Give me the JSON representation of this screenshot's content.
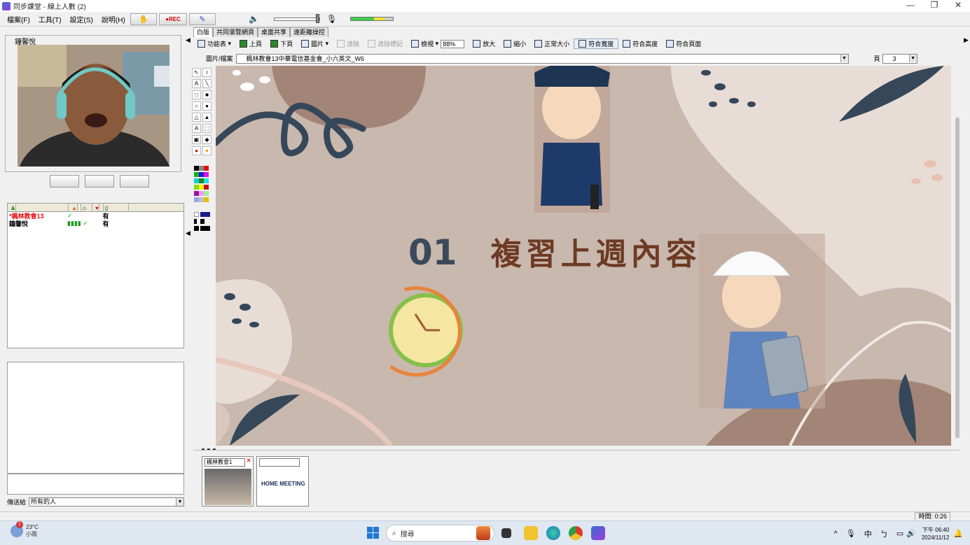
{
  "window": {
    "title": "同步課堂 - 線上人數 (2)",
    "controls": [
      "—",
      "❐",
      "✕"
    ]
  },
  "menu": {
    "items": [
      "檔案(F)",
      "工具(T)",
      "設定(S)",
      "說明(H)"
    ]
  },
  "toolbar": {
    "rec_label": "●REC"
  },
  "video": {
    "label": "鐘馨悅"
  },
  "users": {
    "rows": [
      {
        "name": "*楓林教會13",
        "status": "✓",
        "val": "有",
        "color": "#e01010"
      },
      {
        "name": "鐘馨悅",
        "status": "▮▮▮▮ ✓",
        "val": "有",
        "color": "#000000"
      }
    ]
  },
  "chat": {
    "send_to_label": "傳送給",
    "send_to_value": "所有的人"
  },
  "tabs": [
    {
      "label": "白版",
      "active": true
    },
    {
      "label": "共同瀏覽網頁",
      "active": false
    },
    {
      "label": "桌面共享",
      "active": false
    },
    {
      "label": "遠距離操控",
      "active": false
    }
  ],
  "whiteboard_toolbar": {
    "function_table": "功能表",
    "prev_page": "上頁",
    "next_page": "下頁",
    "image": "圖片",
    "clear": "清除",
    "clear_marks": "清除標記",
    "view": "檢視",
    "zoom_value": "88%",
    "zoom_in": "放大",
    "zoom_out": "縮小",
    "normal_size": "正常大小",
    "fit_width": "符合寬度",
    "fit_height": "符合高度",
    "fit_page": "符合頁面"
  },
  "path": {
    "label": "圖片/檔案",
    "value": "楓林教會13中華電信基金會_小六英文_W6",
    "page_label": "頁",
    "page_value": "3"
  },
  "slide": {
    "number": "01",
    "title": "複習上週內容"
  },
  "thumbnails": [
    {
      "select": "楓林教會1"
    },
    {
      "select": "",
      "logo": "HOME MEETING"
    }
  ],
  "status": {
    "time": "時間: 0:26"
  },
  "taskbar": {
    "weather_temp": "23°C",
    "weather_desc": "小雨",
    "weather_badge": "1",
    "search_placeholder": "搜尋",
    "ime": "中",
    "clock_time": "下午 06:40",
    "clock_date": "2024/11/12"
  },
  "colors": {
    "slide_bg": "#c8b8ae",
    "title_num": "#3b4a5a",
    "title_text": "#6e3a23",
    "taskbar_bg": "#dfe7f1"
  }
}
